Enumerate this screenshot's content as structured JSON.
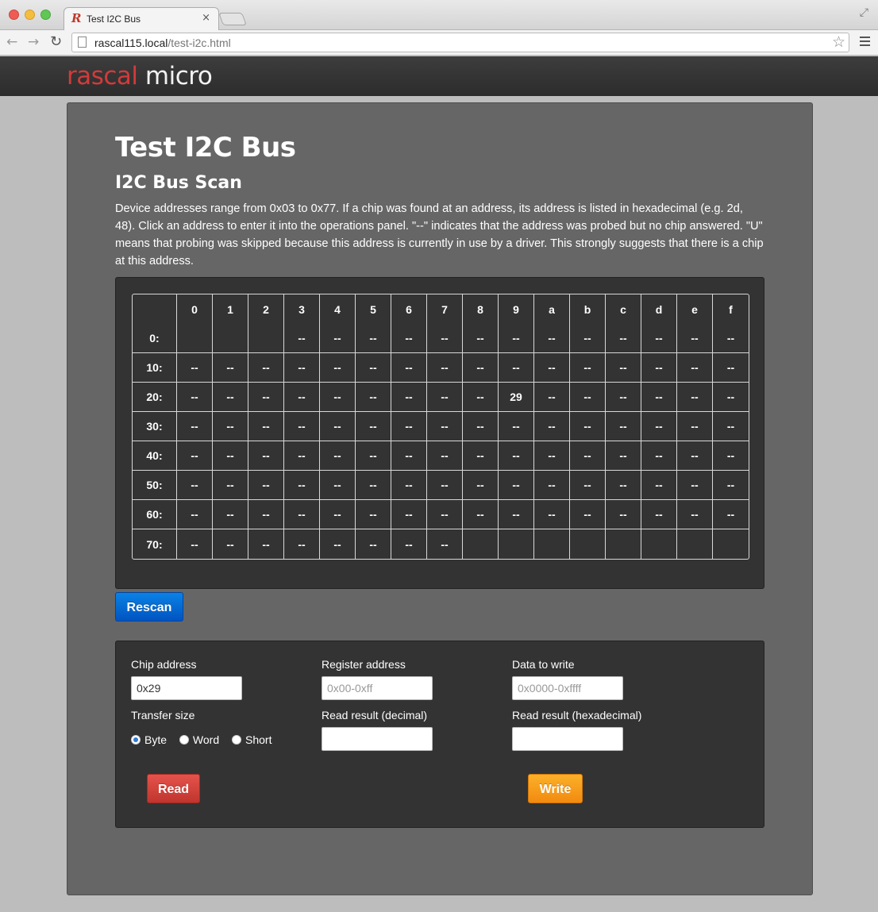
{
  "browser": {
    "tab_title": "Test I2C Bus",
    "tab_favicon": "R",
    "tab_close": "×",
    "url_host": "rascal115.local",
    "url_path": "/test-i2c.html"
  },
  "site": {
    "logo_part1": "rascal",
    "logo_part2": " micro",
    "logo_color": "#d33a3a"
  },
  "page": {
    "title": "Test I2C Bus",
    "section_title": "I2C Bus Scan",
    "description": "Device addresses range from 0x03 to 0x77. If a chip was found at an address, its address is listed in hexadecimal (e.g. 2d, 48). Click an address to enter it into the operations panel. \"--\" indicates that the address was probed but no chip answered. \"U\" means that probing was skipped because this address is currently in use by a driver. This strongly suggests that there is a chip at this address."
  },
  "scan_table": {
    "columns": [
      "0",
      "1",
      "2",
      "3",
      "4",
      "5",
      "6",
      "7",
      "8",
      "9",
      "a",
      "b",
      "c",
      "d",
      "e",
      "f"
    ],
    "rows": [
      {
        "label": "0:",
        "cells": [
          "",
          "",
          "",
          "--",
          "--",
          "--",
          "--",
          "--",
          "--",
          "--",
          "--",
          "--",
          "--",
          "--",
          "--",
          "--"
        ]
      },
      {
        "label": "10:",
        "cells": [
          "--",
          "--",
          "--",
          "--",
          "--",
          "--",
          "--",
          "--",
          "--",
          "--",
          "--",
          "--",
          "--",
          "--",
          "--",
          "--"
        ]
      },
      {
        "label": "20:",
        "cells": [
          "--",
          "--",
          "--",
          "--",
          "--",
          "--",
          "--",
          "--",
          "--",
          "29",
          "--",
          "--",
          "--",
          "--",
          "--",
          "--"
        ]
      },
      {
        "label": "30:",
        "cells": [
          "--",
          "--",
          "--",
          "--",
          "--",
          "--",
          "--",
          "--",
          "--",
          "--",
          "--",
          "--",
          "--",
          "--",
          "--",
          "--"
        ]
      },
      {
        "label": "40:",
        "cells": [
          "--",
          "--",
          "--",
          "--",
          "--",
          "--",
          "--",
          "--",
          "--",
          "--",
          "--",
          "--",
          "--",
          "--",
          "--",
          "--"
        ]
      },
      {
        "label": "50:",
        "cells": [
          "--",
          "--",
          "--",
          "--",
          "--",
          "--",
          "--",
          "--",
          "--",
          "--",
          "--",
          "--",
          "--",
          "--",
          "--",
          "--"
        ]
      },
      {
        "label": "60:",
        "cells": [
          "--",
          "--",
          "--",
          "--",
          "--",
          "--",
          "--",
          "--",
          "--",
          "--",
          "--",
          "--",
          "--",
          "--",
          "--",
          "--"
        ]
      },
      {
        "label": "70:",
        "cells": [
          "--",
          "--",
          "--",
          "--",
          "--",
          "--",
          "--",
          "--",
          "",
          "",
          "",
          "",
          "",
          "",
          "",
          ""
        ]
      }
    ]
  },
  "buttons": {
    "rescan": "Rescan",
    "read": "Read",
    "write": "Write"
  },
  "ops": {
    "chip_address_label": "Chip address",
    "chip_address_value": "0x29",
    "register_address_label": "Register address",
    "register_address_placeholder": "0x00-0xff",
    "data_to_write_label": "Data to write",
    "data_to_write_placeholder": "0x0000-0xffff",
    "transfer_size_label": "Transfer size",
    "transfer_options": [
      "Byte",
      "Word",
      "Short"
    ],
    "transfer_selected": "Byte",
    "read_decimal_label": "Read result (decimal)",
    "read_hex_label": "Read result (hexadecimal)",
    "read_decimal_value": "",
    "read_hex_value": ""
  }
}
